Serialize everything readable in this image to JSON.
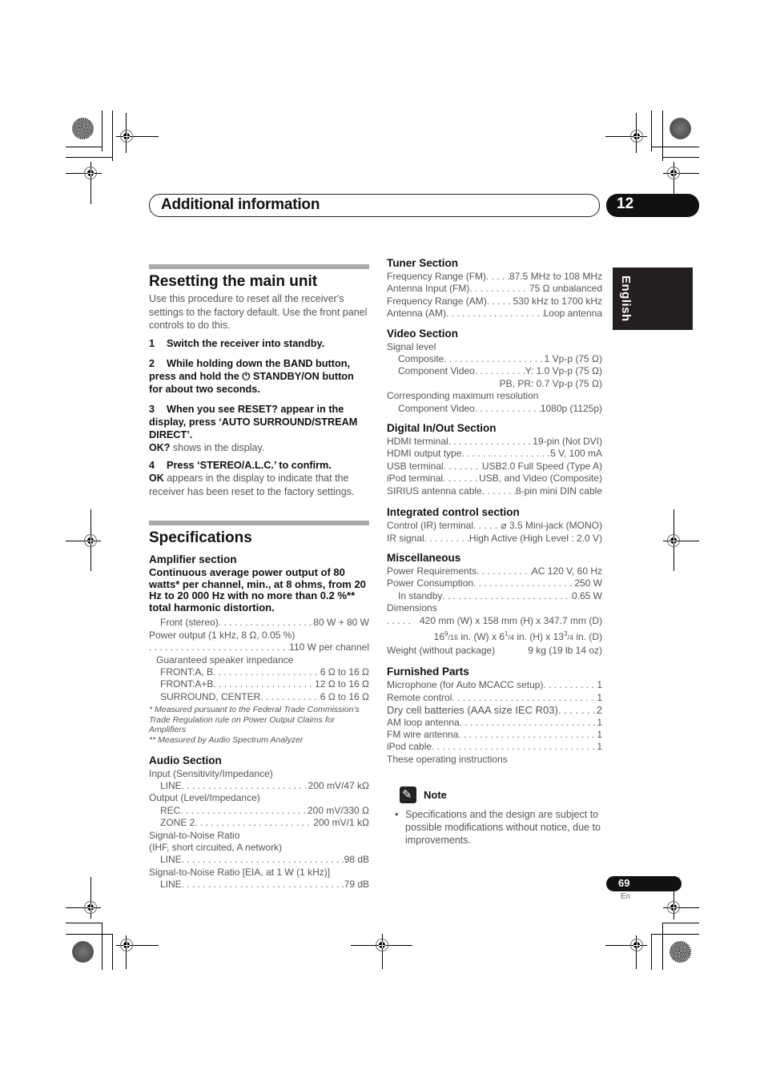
{
  "header": {
    "chapter_title": "Additional information",
    "chapter_number": "12"
  },
  "language_tab": "English",
  "reset": {
    "title": "Resetting the main unit",
    "intro": "Use this procedure to reset all the receiver's settings to the factory default. Use the front panel controls to do this.",
    "steps": [
      {
        "num": "1",
        "text": "Switch the receiver into standby."
      },
      {
        "num": "2",
        "text": "While holding down the BAND button, press and hold the ⏻ STANDBY/ON button for about two seconds."
      },
      {
        "num": "3",
        "text": "When you see RESET? appear in the display, press ‘AUTO SURROUND/STREAM DIRECT’.",
        "result_bold": "OK?",
        "result_text": " shows in the display."
      },
      {
        "num": "4",
        "text": "Press ‘STEREO/A.L.C.’ to confirm.",
        "result_bold": "OK",
        "result_text": " appears in the display to indicate that the receiver has been reset to the factory settings."
      }
    ]
  },
  "specs": {
    "title": "Specifications",
    "amplifier": {
      "heading": "Amplifier section",
      "lead": "Continuous average power output of 80 watts* per channel, min., at 8 ohms, from 20 Hz to 20 000 Hz with no more than 0.2 %** total harmonic distortion.",
      "front_stereo": {
        "label": "Front (stereo)",
        "value": "80 W + 80 W"
      },
      "power_output_label": "Power output (1 kHz, 8 Ω, 0.05 %)",
      "power_output_value": "110 W per channel",
      "impedance_label": "Guaranteed speaker impedance",
      "impedance": [
        {
          "label": "FRONT:A, B",
          "value": "6 Ω to 16 Ω"
        },
        {
          "label": "FRONT:A+B",
          "value": "12 Ω to 16 Ω"
        },
        {
          "label": "SURROUND, CENTER",
          "value": "6 Ω to 16 Ω"
        }
      ],
      "footnote1": "* Measured pursuant to the Federal Trade Commission’s Trade Regulation rule on Power Output Claims for Amplifiers",
      "footnote2": "** Measured by Audio Spectrum Analyzer"
    },
    "audio": {
      "heading": "Audio Section",
      "input_label": "Input (Sensitivity/Impedance)",
      "input_line": {
        "label": "LINE",
        "value": "200 mV/47 kΩ"
      },
      "output_label": "Output (Level/Impedance)",
      "output_rec": {
        "label": "REC",
        "value": "200 mV/330 Ω"
      },
      "output_zone2": {
        "label": "ZONE 2",
        "value": "200 mV/1 kΩ"
      },
      "snr1_label": "Signal-to-Noise Ratio",
      "snr1_sub": "(IHF, short circuited, A network)",
      "snr1_line": {
        "label": "LINE",
        "value": "98 dB"
      },
      "snr2_label": "Signal-to-Noise Ratio [EIA, at 1 W (1 kHz)]",
      "snr2_line": {
        "label": "LINE",
        "value": "79 dB"
      }
    },
    "tuner": {
      "heading": "Tuner Section",
      "rows": [
        {
          "label": "Frequency Range (FM)",
          "value": "87.5 MHz to 108 MHz"
        },
        {
          "label": "Antenna Input (FM)",
          "value": "75 Ω unbalanced"
        },
        {
          "label": "Frequency Range (AM)",
          "value": "530 kHz to 1700 kHz"
        },
        {
          "label": "Antenna (AM)",
          "value": "Loop antenna"
        }
      ]
    },
    "video": {
      "heading": "Video Section",
      "signal_level": "Signal level",
      "composite": {
        "label": "Composite",
        "value": "1 Vp-p (75 Ω)"
      },
      "component": {
        "label": "Component Video",
        "value": "Y: 1.0 Vp-p (75 Ω)"
      },
      "component_pb_pr": "PB, PR: 0.7 Vp-p (75 Ω)",
      "max_res_label": "Corresponding maximum resolution",
      "max_res": {
        "label": "Component Video",
        "value": "1080p (1125p)"
      }
    },
    "digital": {
      "heading": "Digital In/Out Section",
      "rows": [
        {
          "label": "HDMI terminal",
          "value": "19-pin (Not DVI)"
        },
        {
          "label": "HDMI output type",
          "value": "5 V, 100 mA"
        },
        {
          "label": "USB terminal",
          "value": "USB2.0 Full Speed (Type A)"
        },
        {
          "label": "iPod terminal",
          "value": "USB, and Video (Composite)"
        },
        {
          "label": "SIRIUS antenna cable",
          "value": "8-pin mini DIN cable"
        }
      ]
    },
    "integrated": {
      "heading": "Integrated control section",
      "rows": [
        {
          "label": "Control (IR) terminal",
          "value": "⌀ 3.5 Mini-jack (MONO)"
        },
        {
          "label": "IR signal",
          "value": "High Active (High Level : 2.0 V)"
        }
      ]
    },
    "misc": {
      "heading": "Miscellaneous",
      "power_req": {
        "label": "Power Requirements",
        "value": "AC 120 V, 60 Hz"
      },
      "power_cons": {
        "label": "Power Consumption",
        "value": "250 W"
      },
      "standby": {
        "label": "In standby",
        "value": "0.65 W"
      },
      "dimensions_label": "Dimensions",
      "dimensions_mm": "420 mm (W) x 158 mm (H) x 347.7 mm (D)",
      "dimensions_in": {
        "w_whole": "16",
        "w_num": "9",
        "w_den": "16",
        "h_whole": "6",
        "h_num": "1",
        "h_den": "4",
        "d_whole": "13",
        "d_num": "3",
        "d_den": "4"
      },
      "weight": {
        "label": "Weight (without package)",
        "value": "9 kg (19 lb 14 oz)"
      }
    },
    "furnished": {
      "heading": "Furnished Parts",
      "rows": [
        {
          "label": "Microphone (for Auto MCACC setup)",
          "value": "1"
        },
        {
          "label": "Remote control",
          "value": "1"
        },
        {
          "label": "Dry cell batteries (AAA size IEC R03)",
          "value": "2"
        },
        {
          "label": "AM loop antenna",
          "value": "1"
        },
        {
          "label": "FM wire antenna",
          "value": "1"
        },
        {
          "label": "iPod cable",
          "value": "1"
        }
      ],
      "last": "These operating instructions"
    },
    "note": {
      "title": "Note",
      "items": [
        "Specifications and the design are subject to possible modifications without notice, due to improvements."
      ]
    }
  },
  "footer": {
    "page_number": "69",
    "page_lang": "En"
  }
}
